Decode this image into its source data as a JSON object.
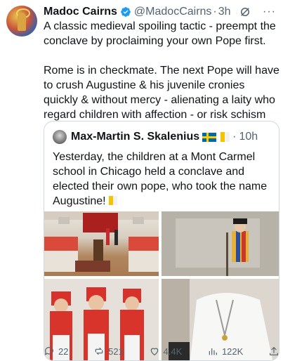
{
  "tweet": {
    "author_name": "Madoc Cairns",
    "handle": "@MadocCairns",
    "separator": "·",
    "time": "3h",
    "more": "···",
    "paragraphs": [
      "A classic medieval spoiling tactic - preempt the conclave by proclaiming your own Pope first.",
      "Rome is in checkmate. The next Pope will have to crush Augustine & his juvenile cronies quickly & without mercy - alienating a laity who regard children with affection - or risk schism"
    ]
  },
  "quote": {
    "author_name": "Max-Martin S. Skalenius",
    "separator": "·",
    "time": "10h",
    "text": "Yesterday, the children at a Mont Carmel school in Chicago held a conclave and elected their own pope, who took the name Augustine!"
  },
  "actions": {
    "replies": "22",
    "reposts": "521",
    "likes": "4.4K",
    "views": "122K"
  },
  "colors": {
    "verified": "#1d9bf0",
    "secondary_text": "#536471",
    "border": "#cfd9de"
  }
}
